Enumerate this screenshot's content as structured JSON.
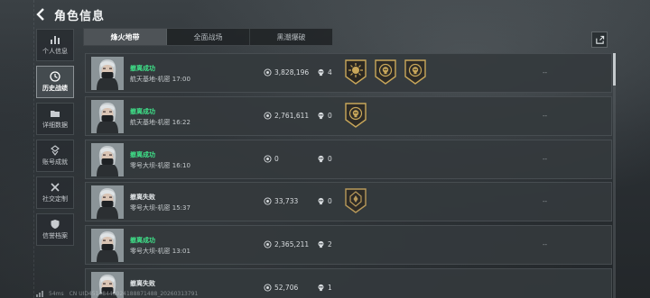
{
  "header": {
    "title": "角色信息"
  },
  "sidebar": {
    "items": [
      {
        "label": "个人信息",
        "icon": "bar-chart-icon",
        "active": false
      },
      {
        "label": "历史战绩",
        "icon": "history-icon",
        "active": true
      },
      {
        "label": "详细数据",
        "icon": "folder-icon",
        "active": false
      },
      {
        "label": "账号成就",
        "icon": "achievement-icon",
        "active": false
      },
      {
        "label": "社交定制",
        "icon": "tools-icon",
        "active": false
      },
      {
        "label": "信誉档案",
        "icon": "shield-icon",
        "active": false
      }
    ]
  },
  "tabs": [
    {
      "label": "烽火地带",
      "active": true
    },
    {
      "label": "全面战场",
      "active": false
    },
    {
      "label": "黑潮爆破",
      "active": false
    }
  ],
  "matches": [
    {
      "status": "撤离成功",
      "result": "success",
      "location": "航天基地-机密 17:00",
      "money": "3,828,196",
      "kills": "4",
      "badges": [
        "sun-emblem-badge",
        "skull-crest-badge",
        "skull-crest-badge"
      ],
      "extra": "--"
    },
    {
      "status": "撤离成功",
      "result": "success",
      "location": "航天基地-机密 16:22",
      "money": "2,761,611",
      "kills": "0",
      "badges": [
        "skull-crest-badge"
      ],
      "extra": "--"
    },
    {
      "status": "撤离成功",
      "result": "success",
      "location": "零号大坝-机密 16:10",
      "money": "0",
      "kills": "0",
      "badges": [],
      "extra": "--"
    },
    {
      "status": "撤离失败",
      "result": "fail",
      "location": "零号大坝-机密 15:37",
      "money": "33,733",
      "kills": "0",
      "badges": [
        "banner-badge"
      ],
      "extra": "--"
    },
    {
      "status": "撤离成功",
      "result": "success",
      "location": "零号大坝-机密 13:01",
      "money": "2,365,211",
      "kills": "2",
      "badges": [],
      "extra": "--"
    },
    {
      "status": "撤离失败",
      "result": "fail",
      "location": "",
      "money": "52,706",
      "kills": "1",
      "badges": [],
      "extra": ""
    }
  ],
  "footer": {
    "ping": "54ms",
    "uid": "CN UID451484480241888714​88_20260313791"
  },
  "colors": {
    "success": "#3fe38a",
    "fail": "#e8ecee",
    "badge_gold": "#c9a75a"
  }
}
